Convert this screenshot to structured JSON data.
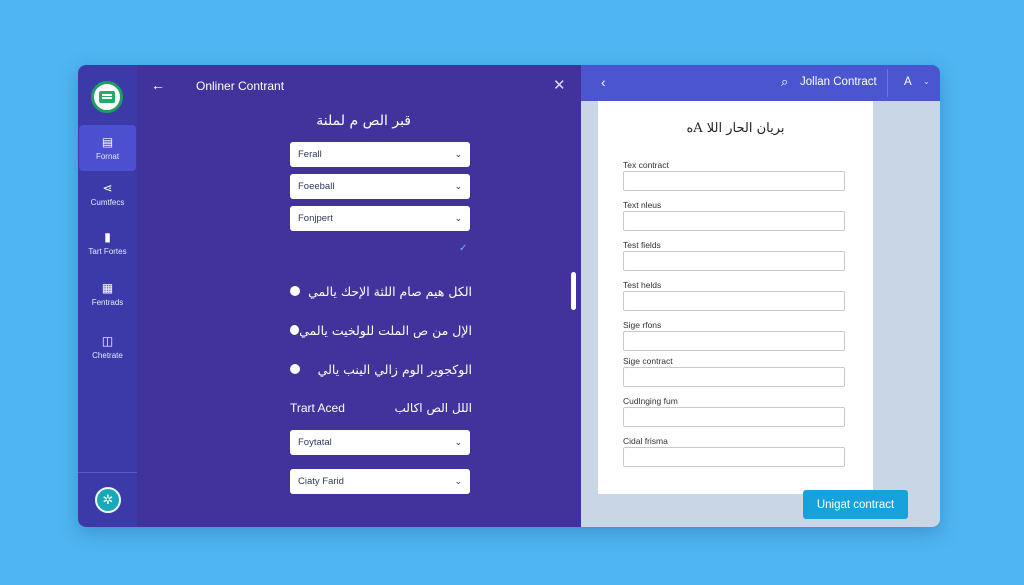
{
  "sidebar": {
    "items": [
      {
        "label": "Fornat",
        "icon": "form-icon",
        "glyph": "▤"
      },
      {
        "label": "Cumtfecs",
        "icon": "share-icon",
        "glyph": "⋖"
      },
      {
        "label": "Tart Fortes",
        "icon": "file-icon",
        "glyph": "▮"
      },
      {
        "label": "Fentrads",
        "icon": "grid-icon",
        "glyph": "▦"
      },
      {
        "label": "Chetrate",
        "icon": "chat-icon",
        "glyph": "◫"
      }
    ],
    "settings_glyph": "✲"
  },
  "panel": {
    "back_glyph": "←",
    "title": "Onliner Contrant",
    "close_glyph": "✕",
    "heading": "قبر الص م لملنة",
    "selects": [
      "Ferall",
      "Foeeball",
      "Fonjpert"
    ],
    "check_glyph": "✓",
    "radios": [
      "الكل هيم صام اللثة الإحك يالمي",
      "الإل من ص الملت للولخيت يالمي",
      "الوكجوير الوم زالي الينب يالي"
    ],
    "track_en": "Trart Aced",
    "track_ar": "اللل الص اكالب",
    "bottom_selects": [
      "Foytatal",
      "Ciaty Farid"
    ],
    "chevron": "⌄"
  },
  "right": {
    "back_glyph": "‹",
    "search_glyph": "⌕",
    "title": "Jollan Contract",
    "user": "A",
    "user_chev": "⌄",
    "doc_title": "بريان الحار اللا Aه",
    "fields": [
      "Tex contract",
      "Text nleus",
      "Test fields",
      "Test helds",
      "Sige rfons",
      "Sige contract",
      "Cudlnging fum",
      "Cidal frisma"
    ],
    "cta": "Unigat contract"
  },
  "colors": {
    "background": "#4fb6f3",
    "sidebar": "#3b3aa8",
    "panel": "#42329b",
    "header": "#4b55cf",
    "accent": "#16a2dc"
  }
}
